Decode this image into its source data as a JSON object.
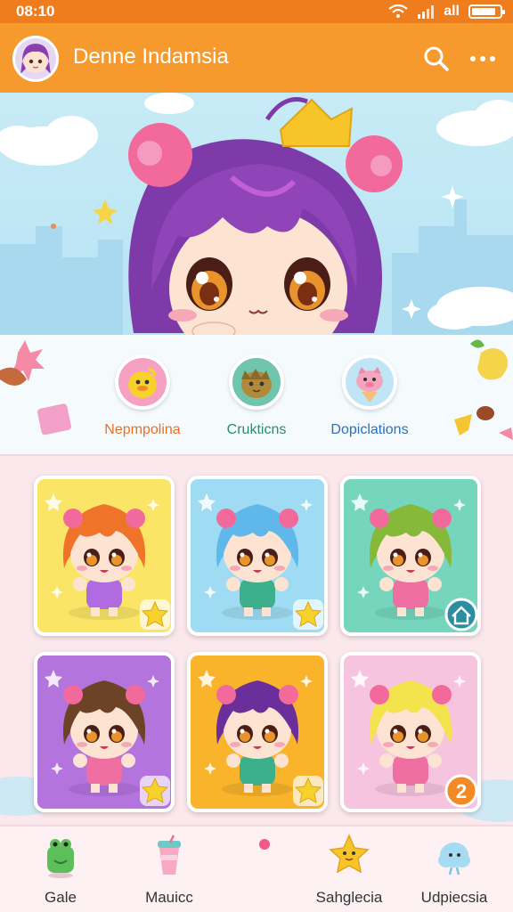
{
  "status_bar": {
    "time": "08:10",
    "carrier": "all",
    "battery_level": 0.85
  },
  "app_bar": {
    "title": "Denne Indamsia",
    "search_icon": "search-icon",
    "more_icon": "more-icon"
  },
  "categories": [
    {
      "label": "Nepmpolina",
      "color": "#e8702a",
      "icon": "duck-icon"
    },
    {
      "label": "Crukticns",
      "color": "#2d8a6b",
      "icon": "hedgehog-icon"
    },
    {
      "label": "Dopiclations",
      "color": "#2f6fb5",
      "icon": "pig-icon"
    }
  ],
  "cards": [
    {
      "bg": "#fbe567",
      "hair": "#f0732a",
      "outfit": "#b06be0",
      "badge": "star-icon"
    },
    {
      "bg": "#9fdcf3",
      "hair": "#5fb7ea",
      "outfit": "#3cb08a",
      "badge": "star-icon"
    },
    {
      "bg": "#76d6bd",
      "hair": "#86b83a",
      "outfit": "#ef6fa2",
      "badge": "home-icon"
    },
    {
      "bg": "#b374dd",
      "hair": "#6d4328",
      "outfit": "#ef6fa2",
      "badge": "star-icon"
    },
    {
      "bg": "#f9b42c",
      "hair": "#6a2f9a",
      "outfit": "#3cb08a",
      "badge": "star-icon"
    },
    {
      "bg": "#f7c4e0",
      "hair": "#f3e34d",
      "outfit": "#ef6fa2",
      "badge_text": "2"
    }
  ],
  "bottom_nav": [
    {
      "label": "Gale",
      "icon": "frog-icon"
    },
    {
      "label": "Mauicc",
      "icon": "drink-icon"
    },
    {
      "label": "Sahglecia",
      "icon": "star-character-icon"
    },
    {
      "label": "Udpiecsia",
      "icon": "cloud-icon"
    }
  ],
  "colors": {
    "accent": "#f79a2e",
    "status": "#ef7d1d",
    "nav_dot": "#ef5a8a"
  }
}
